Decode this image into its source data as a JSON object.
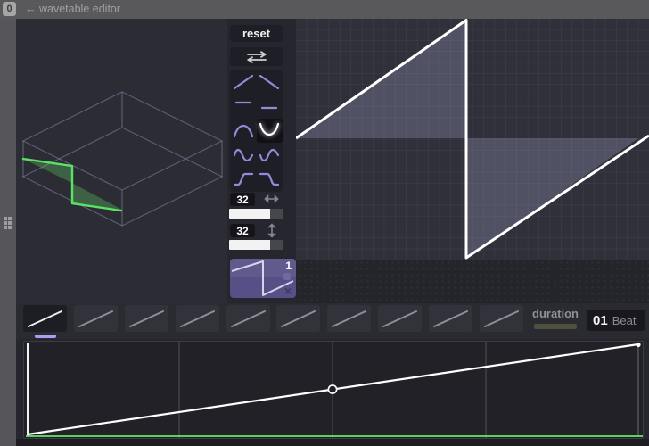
{
  "header": {
    "badge": "0",
    "back_icon": "←",
    "title": "wavetable editor"
  },
  "toolbar": {
    "reset_label": "reset",
    "swap_icon": "swap-direction"
  },
  "shape_palette": {
    "selected_index": 5,
    "shapes": [
      "ramp-up",
      "ramp-down",
      "flat-high",
      "flat-low",
      "hump-up",
      "hump-down",
      "sine",
      "sine-inverted",
      "smoothstep-up",
      "smoothstep-down"
    ]
  },
  "wave_size": {
    "width_value": "32",
    "height_value": "32",
    "width_slider_fill": 0.75,
    "height_slider_fill": 0.75
  },
  "wavetable_slot": {
    "number": "1",
    "close_icon": "×"
  },
  "main_editor": {
    "wave_type": "sawtooth",
    "cycle_points_normalized": [
      [
        0,
        0.5
      ],
      [
        0.482,
        1.0
      ],
      [
        0.482,
        0.0
      ],
      [
        1.0,
        0.49
      ]
    ]
  },
  "view_3d": {
    "wave_color": "#5be263",
    "wireframe_color": "#8a8aae"
  },
  "keyframes": {
    "count": 10,
    "selected_index": 0,
    "shape": "ramp-up"
  },
  "duration": {
    "label": "duration",
    "value": "01",
    "unit": "Beat"
  },
  "envelope": {
    "points_normalized": [
      [
        0,
        0
      ],
      [
        0.5,
        0.5
      ],
      [
        1,
        1
      ]
    ],
    "marker_point_index": 1,
    "baseline_color": "#67e86b",
    "grid_divisions": 4
  },
  "colors": {
    "accent_purple": "#575086",
    "accent_lavender": "#8f8cd8",
    "selection_underline": "#ab9ef0",
    "duration_bar": "#4f4f3d",
    "header_gray": "#59595b"
  }
}
